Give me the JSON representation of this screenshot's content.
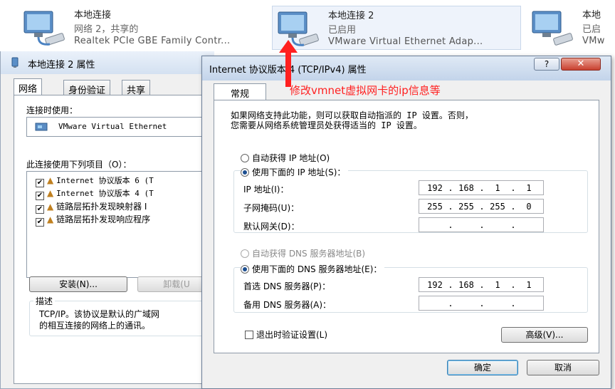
{
  "adapters": [
    {
      "name": "本地连接",
      "status": "网络  2，共享的",
      "device": "Realtek PCIe GBE Family Contr..."
    },
    {
      "name": "本地连接 2",
      "status": "已启用",
      "device": "VMware Virtual Ethernet Adap..."
    },
    {
      "name": "本地",
      "status": "已启",
      "device": "VMw"
    }
  ],
  "props_window": {
    "title": "本地连接 2 属性",
    "tabs": [
      "网络",
      "身份验证",
      "共享"
    ],
    "connect_using_label": "连接时使用：",
    "adapter_name": "VMware Virtual Ethernet",
    "items_label": "此连接使用下列项目（O）：",
    "items": [
      {
        "label": "Internet 协议版本 6 (T",
        "checked": true
      },
      {
        "label": "Internet 协议版本 4 (T",
        "checked": true
      },
      {
        "label": "链路层拓扑发现映射器 I",
        "checked": true
      },
      {
        "label": "链路层拓扑发现响应程序",
        "checked": true
      }
    ],
    "install_button": "安装(N)...",
    "uninstall_button": "卸载(U",
    "description_label": "描述",
    "description_text_1": "TCP/IP。该协议是默认的广域网",
    "description_text_2": "的相互连接的网络上的通讯。"
  },
  "ipv4_dialog": {
    "title": "Internet 协议版本 4 (TCP/IPv4) 属性",
    "help_button": "?",
    "close_button": "✕",
    "tab": "常规",
    "intro_1": "如果网络支持此功能，则可以获取自动指派的 IP 设置。否则，",
    "intro_2": "您需要从网络系统管理员处获得适当的 IP 设置。",
    "auto_ip": "自动获得 IP 地址(O)",
    "manual_ip": "使用下面的 IP 地址(S)：",
    "ip_label": "IP 地址(I)：",
    "ip_value": [
      "192",
      "168",
      "1",
      "1"
    ],
    "mask_label": "子网掩码(U)：",
    "mask_value": [
      "255",
      "255",
      "255",
      "0"
    ],
    "gateway_label": "默认网关(D)：",
    "auto_dns": "自动获得 DNS 服务器地址(B)",
    "manual_dns": "使用下面的 DNS 服务器地址(E)：",
    "dns1_label": "首选 DNS 服务器(P)：",
    "dns1_value": [
      "192",
      "168",
      "1",
      "1"
    ],
    "dns2_label": "备用 DNS 服务器(A)：",
    "validate_label": "退出时验证设置(L)",
    "advanced_button": "高级(V)...",
    "ok_button": "确定",
    "cancel_button": "取消"
  },
  "annotation": {
    "text": "修改vmnet虚拟网卡的ip信息等",
    "color": "#ff2020"
  }
}
